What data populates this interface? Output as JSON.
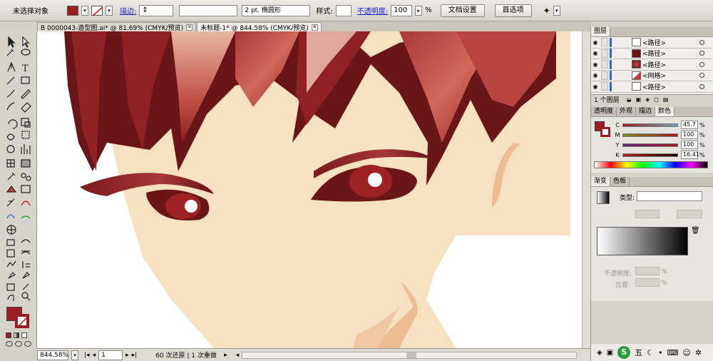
{
  "control_bar": {
    "selection_label": "未选择对象",
    "stroke_link": "描边:",
    "stroke_weight": "",
    "brush_label": "2 pt. 椭圆形",
    "style_label": "样式:",
    "opacity_link": "不透明度:",
    "opacity_value": "100",
    "opacity_unit": "%",
    "doc_setup_button": "文档设置",
    "prefs_button": "首选项",
    "fill_color": "#9b1d21"
  },
  "tabs": [
    {
      "label": "B 0000043-造型图.ai* @ 81.69% (CMYK/预览)",
      "active": false
    },
    {
      "label": "未标题-1* @ 844.58% (CMYK/预览)",
      "active": true
    }
  ],
  "status_bar": {
    "zoom": "844.58%",
    "page": "1",
    "history": "60 次还原 | 1 次重做"
  },
  "layers_panel": {
    "tab_label": "图层",
    "rows": [
      {
        "label": "<路径>"
      },
      {
        "label": "<路径>"
      },
      {
        "label": "<路径>"
      },
      {
        "label": "<网格>"
      },
      {
        "label": "<路径>"
      }
    ],
    "footer_count": "1 个图层"
  },
  "color_panel": {
    "tabs": [
      "透明度",
      "外观",
      "描边",
      "颜色"
    ],
    "active_tab": "颜色",
    "channels": [
      {
        "name": "C",
        "value": "45.7",
        "unit": "%"
      },
      {
        "name": "M",
        "value": "100",
        "unit": "%"
      },
      {
        "name": "Y",
        "value": "100",
        "unit": "%"
      },
      {
        "name": "K",
        "value": "16.41",
        "unit": "%"
      }
    ]
  },
  "gradient_panel": {
    "tabs": [
      "渐变",
      "色板"
    ],
    "active_tab": "渐变",
    "type_label": "类型:",
    "opacity_label": "不透明度:",
    "opacity_unit": "%",
    "location_label": "位置:",
    "location_unit": "%"
  },
  "taskbar": {
    "ime_label": "五"
  },
  "colors": {
    "hair_dark": "#6a1518",
    "hair_mid": "#8f2125",
    "hair_light": "#c8544a",
    "skin": "#f6e1c1",
    "skin_shadow": "#eebd93",
    "eye_red": "#9c2226"
  }
}
